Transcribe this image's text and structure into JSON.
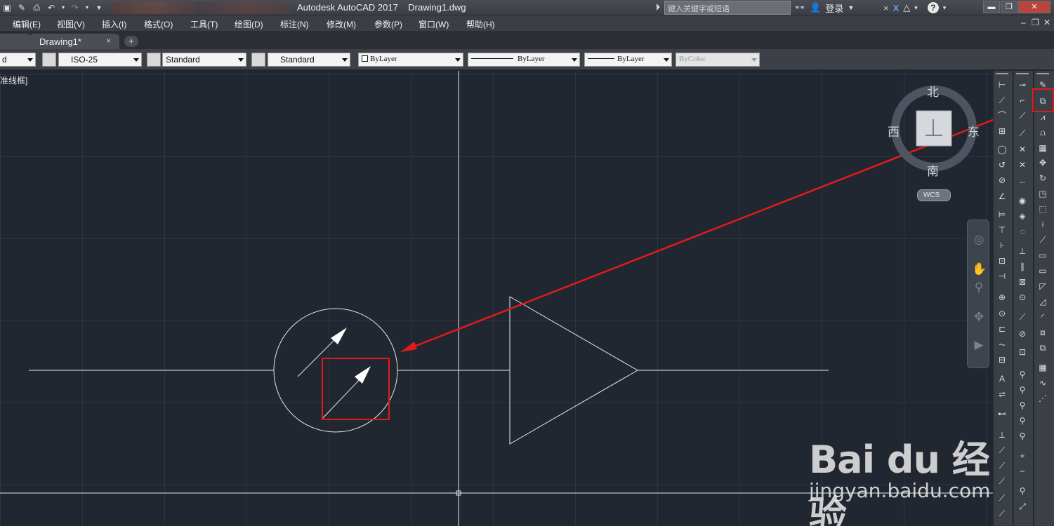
{
  "titlebar": {
    "app_title": "Autodesk AutoCAD 2017",
    "doc_title": "Drawing1.dwg",
    "search_placeholder": "键入关键字或短语",
    "login_label": "登录",
    "help_icon": "?"
  },
  "menubar": {
    "items": [
      {
        "label": "编辑(E)"
      },
      {
        "label": "视图(V)"
      },
      {
        "label": "插入(I)"
      },
      {
        "label": "格式(O)"
      },
      {
        "label": "工具(T)"
      },
      {
        "label": "绘图(D)"
      },
      {
        "label": "标注(N)"
      },
      {
        "label": "修改(M)"
      },
      {
        "label": "参数(P)"
      },
      {
        "label": "窗口(W)"
      },
      {
        "label": "帮助(H)"
      }
    ]
  },
  "tabs": {
    "active_label": "Drawing1*",
    "close_glyph": "×",
    "new_glyph": "+"
  },
  "toolbar": {
    "partial_dropdown": "d",
    "dim_style": "ISO-25",
    "text_style": "Standard",
    "table_style": "Standard",
    "layer_color": "ByLayer",
    "linetype": "ByLayer",
    "lineweight": "ByLayer",
    "plot_style": "ByColor"
  },
  "canvas": {
    "view_label": "准线框]",
    "compass": {
      "north": "北",
      "south": "南",
      "west": "西",
      "east": "东"
    },
    "wcs_label": "WCS"
  },
  "watermark": {
    "logo": "Bai du 经验",
    "url": "jingyan.baidu.com"
  },
  "colors": {
    "canvas_bg": "#212731",
    "annotation_red": "#e21a1a",
    "linework": "#e8e8e8"
  }
}
